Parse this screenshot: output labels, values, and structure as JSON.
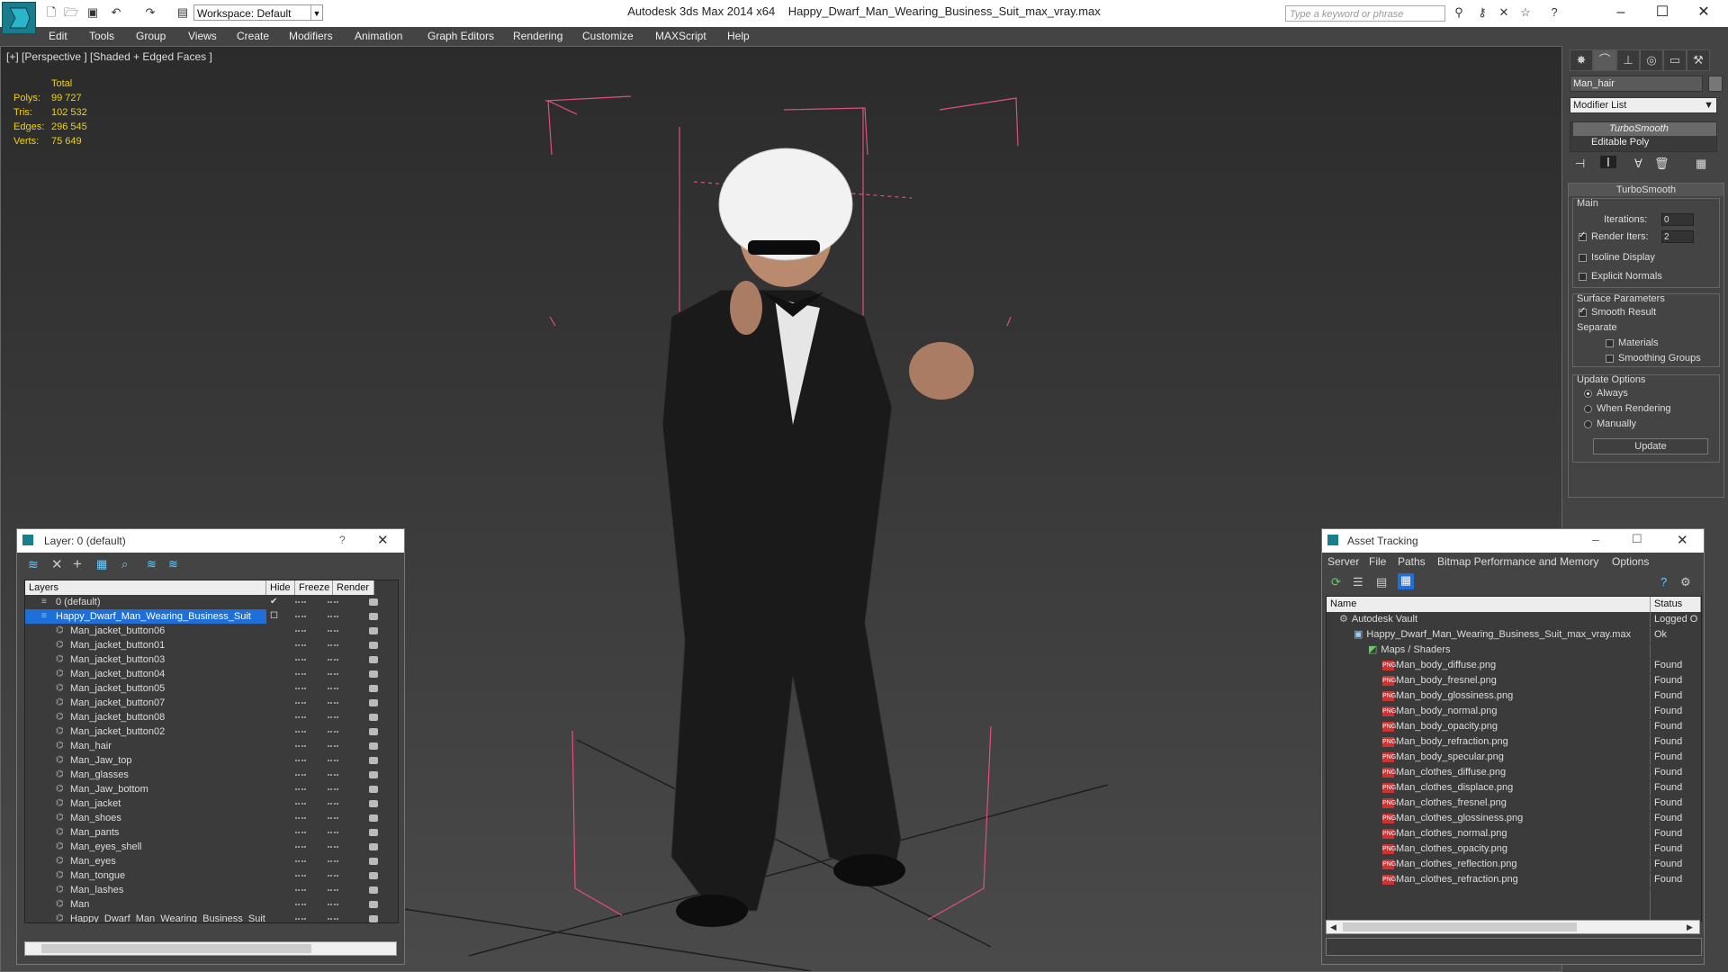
{
  "titlebar": {
    "app_title": "Autodesk 3ds Max  2014 x64",
    "file_title": "Happy_Dwarf_Man_Wearing_Business_Suit_max_vray.max",
    "workspace_label": "Workspace: Default",
    "search_placeholder": "Type a keyword or phrase"
  },
  "menu": [
    "Edit",
    "Tools",
    "Group",
    "Views",
    "Create",
    "Modifiers",
    "Animation",
    "Graph Editors",
    "Rendering",
    "Customize",
    "MAXScript",
    "Help"
  ],
  "viewport": {
    "label": "[+] [Perspective ] [Shaded + Edged Faces ]",
    "stats": {
      "header": "Total",
      "rows": [
        {
          "label": "Polys:",
          "value": "99 727"
        },
        {
          "label": "Tris:",
          "value": "102 532"
        },
        {
          "label": "Edges:",
          "value": "296 545"
        },
        {
          "label": "Verts:",
          "value": "75 649"
        }
      ]
    }
  },
  "command_panel": {
    "object_name": "Man_hair",
    "modifier_list": "Modifier List",
    "stack": [
      "TurboSmooth",
      "Editable Poly"
    ],
    "rollout_title": "TurboSmooth",
    "main_label": "Main",
    "iterations_label": "Iterations:",
    "iterations_value": "0",
    "render_iters_label": "Render Iters:",
    "render_iters_value": "2",
    "isoline_label": "Isoline Display",
    "explicit_normals_label": "Explicit Normals",
    "surface_params_label": "Surface Parameters",
    "smooth_result_label": "Smooth Result",
    "separate_label": "Separate",
    "materials_label": "Materials",
    "smoothing_groups_label": "Smoothing Groups",
    "update_options_label": "Update Options",
    "always_label": "Always",
    "when_rendering_label": "When Rendering",
    "manually_label": "Manually",
    "update_button": "Update"
  },
  "layer_dialog": {
    "title": "Layer: 0 (default)",
    "help": "?",
    "columns": [
      "Layers",
      "Hide",
      "Freeze",
      "Render"
    ],
    "layers": [
      {
        "name": "0 (default)",
        "level": 0
      },
      {
        "name": "Happy_Dwarf_Man_Wearing_Business_Suit",
        "level": 0,
        "selected": true
      },
      {
        "name": "Man_jacket_button06",
        "level": 1
      },
      {
        "name": "Man_jacket_button01",
        "level": 1
      },
      {
        "name": "Man_jacket_button03",
        "level": 1
      },
      {
        "name": "Man_jacket_button04",
        "level": 1
      },
      {
        "name": "Man_jacket_button05",
        "level": 1
      },
      {
        "name": "Man_jacket_button07",
        "level": 1
      },
      {
        "name": "Man_jacket_button08",
        "level": 1
      },
      {
        "name": "Man_jacket_button02",
        "level": 1
      },
      {
        "name": "Man_hair",
        "level": 1
      },
      {
        "name": "Man_Jaw_top",
        "level": 1
      },
      {
        "name": "Man_glasses",
        "level": 1
      },
      {
        "name": "Man_Jaw_bottom",
        "level": 1
      },
      {
        "name": "Man_jacket",
        "level": 1
      },
      {
        "name": "Man_shoes",
        "level": 1
      },
      {
        "name": "Man_pants",
        "level": 1
      },
      {
        "name": "Man_eyes_shell",
        "level": 1
      },
      {
        "name": "Man_eyes",
        "level": 1
      },
      {
        "name": "Man_tongue",
        "level": 1
      },
      {
        "name": "Man_lashes",
        "level": 1
      },
      {
        "name": "Man",
        "level": 1
      },
      {
        "name": "Happy_Dwarf_Man_Wearing_Business_Suit",
        "level": 1
      }
    ]
  },
  "asset_dialog": {
    "title": "Asset Tracking",
    "menu": [
      "Server",
      "File",
      "Paths",
      "Bitmap Performance and Memory",
      "Options"
    ],
    "columns": [
      "Name",
      "Status"
    ],
    "rows": [
      {
        "name": "Autodesk Vault",
        "status": "Logged O",
        "level": 0,
        "icon": "vault"
      },
      {
        "name": "Happy_Dwarf_Man_Wearing_Business_Suit_max_vray.max",
        "status": "Ok",
        "level": 1,
        "icon": "max"
      },
      {
        "name": "Maps / Shaders",
        "status": "",
        "level": 2,
        "icon": "maps"
      },
      {
        "name": "Man_body_diffuse.png",
        "status": "Found",
        "level": 3,
        "icon": "png"
      },
      {
        "name": "Man_body_fresnel.png",
        "status": "Found",
        "level": 3,
        "icon": "png"
      },
      {
        "name": "Man_body_glossiness.png",
        "status": "Found",
        "level": 3,
        "icon": "png"
      },
      {
        "name": "Man_body_normal.png",
        "status": "Found",
        "level": 3,
        "icon": "png"
      },
      {
        "name": "Man_body_opacity.png",
        "status": "Found",
        "level": 3,
        "icon": "png"
      },
      {
        "name": "Man_body_refraction.png",
        "status": "Found",
        "level": 3,
        "icon": "png"
      },
      {
        "name": "Man_body_specular.png",
        "status": "Found",
        "level": 3,
        "icon": "png"
      },
      {
        "name": "Man_clothes_diffuse.png",
        "status": "Found",
        "level": 3,
        "icon": "png"
      },
      {
        "name": "Man_clothes_displace.png",
        "status": "Found",
        "level": 3,
        "icon": "png"
      },
      {
        "name": "Man_clothes_fresnel.png",
        "status": "Found",
        "level": 3,
        "icon": "png"
      },
      {
        "name": "Man_clothes_glossiness.png",
        "status": "Found",
        "level": 3,
        "icon": "png"
      },
      {
        "name": "Man_clothes_normal.png",
        "status": "Found",
        "level": 3,
        "icon": "png"
      },
      {
        "name": "Man_clothes_opacity.png",
        "status": "Found",
        "level": 3,
        "icon": "png"
      },
      {
        "name": "Man_clothes_reflection.png",
        "status": "Found",
        "level": 3,
        "icon": "png"
      },
      {
        "name": "Man_clothes_refraction.png",
        "status": "Found",
        "level": 3,
        "icon": "png"
      }
    ]
  },
  "colors": {
    "stats_yellow": "#f2d200",
    "selection_blue": "#1e6fd9",
    "bbox_pink": "#e0507a"
  }
}
